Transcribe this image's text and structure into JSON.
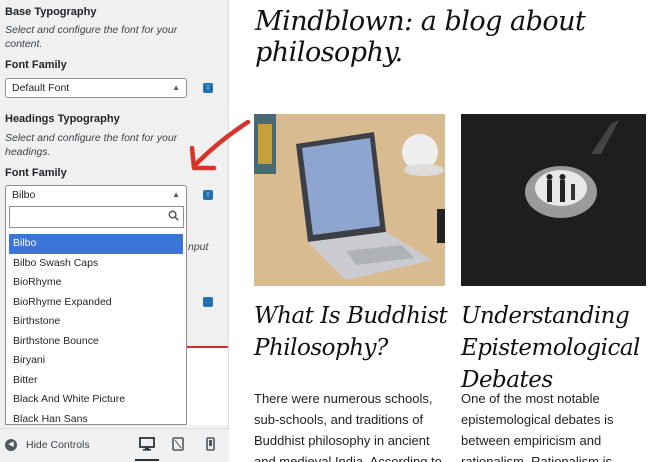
{
  "sidebar": {
    "base": {
      "title": "Base Typography",
      "description": "Select and configure the font for your content.",
      "font_label": "Font Family",
      "font_value": "Default Font"
    },
    "headings": {
      "title": "Headings Typography",
      "description": "Select and configure the font for your headings.",
      "font_label": "Font Family",
      "font_value": "Bilbo"
    },
    "dropdown": {
      "search_value": "",
      "options": [
        "Bilbo",
        "Bilbo Swash Caps",
        "BioRhyme",
        "BioRhyme Expanded",
        "Birthstone",
        "Birthstone Bounce",
        "Biryani",
        "Bitter",
        "Black And White Picture",
        "Black Han Sans"
      ],
      "selected": "Bilbo"
    },
    "obscured_text": "nput",
    "footer": {
      "hide_controls": "Hide Controls"
    }
  },
  "preview": {
    "site_title": "Mindblown: a blog about philosophy.",
    "posts": [
      {
        "title": "What Is Buddhist Philosophy?",
        "excerpt": "There were numerous schools, sub-schools, and traditions of Buddhist philosophy in ancient and medieval India. According to"
      },
      {
        "title": "Understanding Epistemological Debates",
        "excerpt": "One of the most notable epistemological debates is between empiricism and rationalism. Rationalism is"
      }
    ]
  },
  "colors": {
    "accent": "#2271b1",
    "selected": "#3d74d8",
    "arrow": "#d9342b"
  }
}
